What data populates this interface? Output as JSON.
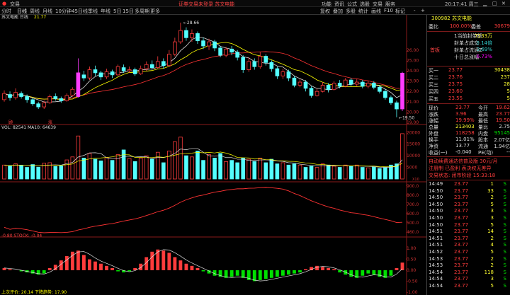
{
  "titlebar": {
    "menu_items": [
      "交易"
    ],
    "notice": "证券交易未登录  苏文电能",
    "right_items": [
      "功能",
      "资讯",
      "公式",
      "选股",
      "交易",
      "服务"
    ],
    "time": "20:17:41 周三",
    "window_buttons": [
      "minimize",
      "maximize",
      "close"
    ]
  },
  "toolbar": {
    "periods": [
      "分时",
      "日线",
      "周线",
      "月线",
      "10分钟",
      "45日线",
      "季线",
      "年线",
      "5日",
      "15日",
      "多周期",
      "更多"
    ],
    "active_period": "日线",
    "right_tabs": [
      "复权",
      "叠加",
      "画线",
      "F10",
      "标记",
      "-",
      "+"
    ],
    "right_tabs2": [
      "复权",
      "叠加",
      "多股",
      "统计",
      "画线",
      "F10",
      "标记"
    ]
  },
  "chart": {
    "stock_label": "苏文电能 日线",
    "ma_label": "21.77",
    "high_marker": "28.66",
    "low_marker": "19.50",
    "signal_labels": [
      "顾",
      "涨"
    ],
    "price_axis": [
      "26.00",
      "25.00",
      "24.00",
      "23.00",
      "22.00",
      "21.00",
      "20.00",
      "19.00"
    ],
    "volume_header": "VOL: 82541  MA10: 64639",
    "volume_axis": [
      "20000",
      "15000",
      "10000",
      "5000"
    ],
    "volume_unit": "X10",
    "mid_axis": [
      "900.0",
      "800.0",
      "700.0",
      "600.0",
      "500.0",
      "460.0"
    ],
    "macd_header": "-0.80  STOCK: -0.04",
    "macd_axis": [
      "1.00",
      "0.50",
      "0.00",
      "-0.50",
      "-1.00"
    ],
    "bottom_text": "上次评价: 20.14  下降趋势: 17.90"
  },
  "chart_data": {
    "type": "candlestick",
    "candles": [
      {
        "o": 21.2,
        "c": 21.8,
        "h": 22.1,
        "l": 21.0
      },
      {
        "o": 21.7,
        "c": 21.4,
        "h": 22.0,
        "l": 21.1
      },
      {
        "o": 21.4,
        "c": 21.9,
        "h": 22.3,
        "l": 21.2
      },
      {
        "o": 21.8,
        "c": 21.5,
        "h": 22.0,
        "l": 21.3
      },
      {
        "o": 21.5,
        "c": 21.2,
        "h": 21.7,
        "l": 20.9
      },
      {
        "o": 21.2,
        "c": 20.8,
        "h": 21.4,
        "l": 20.6
      },
      {
        "o": 20.8,
        "c": 20.5,
        "h": 21.0,
        "l": 20.3
      },
      {
        "o": 20.5,
        "c": 20.9,
        "h": 21.1,
        "l": 20.3
      },
      {
        "o": 20.9,
        "c": 21.5,
        "h": 21.7,
        "l": 20.8
      },
      {
        "o": 21.5,
        "c": 21.3,
        "h": 21.8,
        "l": 21.1
      },
      {
        "o": 21.3,
        "c": 21.1,
        "h": 21.5,
        "l": 20.9
      },
      {
        "o": 21.1,
        "c": 21.6,
        "h": 21.8,
        "l": 21.0
      },
      {
        "o": 21.6,
        "c": 22.2,
        "h": 22.4,
        "l": 21.5
      },
      {
        "o": 21.5,
        "c": 23.8,
        "h": 25.2,
        "l": 21.4
      },
      {
        "o": 23.6,
        "c": 23.3,
        "h": 24.0,
        "l": 23.0
      },
      {
        "o": 23.3,
        "c": 24.1,
        "h": 24.4,
        "l": 23.1
      },
      {
        "o": 24.1,
        "c": 23.8,
        "h": 24.5,
        "l": 23.5
      },
      {
        "o": 23.8,
        "c": 23.4,
        "h": 24.0,
        "l": 23.1
      },
      {
        "o": 23.4,
        "c": 23.9,
        "h": 24.2,
        "l": 23.2
      },
      {
        "o": 23.9,
        "c": 23.6,
        "h": 24.1,
        "l": 23.3
      },
      {
        "o": 23.6,
        "c": 24.4,
        "h": 24.6,
        "l": 23.5
      },
      {
        "o": 24.3,
        "c": 24.0,
        "h": 24.6,
        "l": 23.8
      },
      {
        "o": 24.0,
        "c": 24.1,
        "h": 24.4,
        "l": 23.8
      },
      {
        "o": 24.1,
        "c": 23.7,
        "h": 24.3,
        "l": 23.5
      },
      {
        "o": 23.7,
        "c": 24.2,
        "h": 24.5,
        "l": 23.6
      },
      {
        "o": 24.2,
        "c": 24.6,
        "h": 24.9,
        "l": 24.0
      },
      {
        "o": 24.6,
        "c": 24.3,
        "h": 25.0,
        "l": 24.1
      },
      {
        "o": 24.3,
        "c": 24.9,
        "h": 25.4,
        "l": 24.2
      },
      {
        "o": 24.9,
        "c": 24.5,
        "h": 25.2,
        "l": 24.2
      },
      {
        "o": 24.5,
        "c": 25.6,
        "h": 26.0,
        "l": 24.4
      },
      {
        "o": 25.6,
        "c": 26.8,
        "h": 27.2,
        "l": 25.4
      },
      {
        "o": 26.8,
        "c": 27.9,
        "h": 28.66,
        "l": 26.6
      },
      {
        "o": 27.9,
        "c": 27.2,
        "h": 28.2,
        "l": 26.9
      },
      {
        "o": 27.2,
        "c": 27.6,
        "h": 28.0,
        "l": 26.8
      },
      {
        "o": 27.6,
        "c": 26.9,
        "h": 27.8,
        "l": 26.6
      },
      {
        "o": 26.9,
        "c": 26.4,
        "h": 27.2,
        "l": 26.1
      },
      {
        "o": 26.4,
        "c": 26.8,
        "h": 27.1,
        "l": 26.0
      },
      {
        "o": 26.8,
        "c": 26.2,
        "h": 27.0,
        "l": 25.9
      },
      {
        "o": 26.2,
        "c": 25.5,
        "h": 26.4,
        "l": 25.3
      },
      {
        "o": 25.5,
        "c": 26.1,
        "h": 26.3,
        "l": 25.3
      },
      {
        "o": 26.1,
        "c": 25.8,
        "h": 26.4,
        "l": 25.5
      },
      {
        "o": 25.8,
        "c": 25.3,
        "h": 26.0,
        "l": 25.0
      },
      {
        "o": 25.3,
        "c": 24.1,
        "h": 25.5,
        "l": 23.8
      },
      {
        "o": 24.1,
        "c": 24.9,
        "h": 25.3,
        "l": 23.9
      },
      {
        "o": 24.9,
        "c": 24.4,
        "h": 25.2,
        "l": 24.1
      },
      {
        "o": 24.4,
        "c": 25.4,
        "h": 25.8,
        "l": 24.2
      },
      {
        "o": 25.4,
        "c": 24.8,
        "h": 25.6,
        "l": 24.5
      },
      {
        "o": 24.8,
        "c": 24.2,
        "h": 25.0,
        "l": 23.9
      },
      {
        "o": 24.2,
        "c": 23.5,
        "h": 24.4,
        "l": 23.2
      },
      {
        "o": 23.5,
        "c": 23.9,
        "h": 24.2,
        "l": 23.2
      },
      {
        "o": 23.9,
        "c": 23.3,
        "h": 24.1,
        "l": 23.0
      },
      {
        "o": 23.3,
        "c": 22.6,
        "h": 23.5,
        "l": 22.4
      },
      {
        "o": 22.6,
        "c": 22.9,
        "h": 23.2,
        "l": 22.4
      },
      {
        "o": 22.9,
        "c": 22.3,
        "h": 23.1,
        "l": 22.0
      },
      {
        "o": 22.3,
        "c": 21.6,
        "h": 22.5,
        "l": 21.4
      },
      {
        "o": 21.6,
        "c": 22.0,
        "h": 22.3,
        "l": 21.5
      },
      {
        "o": 22.0,
        "c": 22.6,
        "h": 22.9,
        "l": 21.9
      },
      {
        "o": 22.6,
        "c": 22.2,
        "h": 22.8,
        "l": 21.9
      },
      {
        "o": 22.2,
        "c": 22.8,
        "h": 23.0,
        "l": 22.1
      },
      {
        "o": 22.8,
        "c": 22.5,
        "h": 23.1,
        "l": 22.3
      },
      {
        "o": 22.5,
        "c": 23.1,
        "h": 23.3,
        "l": 22.4
      },
      {
        "o": 23.1,
        "c": 22.7,
        "h": 23.3,
        "l": 22.5
      },
      {
        "o": 22.7,
        "c": 22.9,
        "h": 23.2,
        "l": 22.5
      },
      {
        "o": 22.9,
        "c": 22.5,
        "h": 23.1,
        "l": 22.3
      },
      {
        "o": 22.5,
        "c": 22.8,
        "h": 23.0,
        "l": 22.3
      },
      {
        "o": 22.8,
        "c": 22.4,
        "h": 23.0,
        "l": 22.2
      },
      {
        "o": 22.4,
        "c": 22.0,
        "h": 22.6,
        "l": 21.8
      },
      {
        "o": 22.0,
        "c": 21.4,
        "h": 22.2,
        "l": 21.2
      },
      {
        "o": 21.4,
        "c": 20.9,
        "h": 21.6,
        "l": 20.7
      },
      {
        "o": 20.9,
        "c": 20.3,
        "h": 21.1,
        "l": 19.5
      },
      {
        "o": 20.3,
        "c": 23.77,
        "h": 23.9,
        "l": 20.1
      }
    ],
    "volumes": [
      6.0,
      5.5,
      6.5,
      5.8,
      5.0,
      6.2,
      5.1,
      6.8,
      7.0,
      5.4,
      5.6,
      8.2,
      9.5,
      18.5,
      9.0,
      11.0,
      8.5,
      7.8,
      9.2,
      8.0,
      10.5,
      12.5,
      8.8,
      7.5,
      9.0,
      10.0,
      8.5,
      11.5,
      7.0,
      12.0,
      16.0,
      18.0,
      10.0,
      9.5,
      12.0,
      8.0,
      10.5,
      9.0,
      11.0,
      7.5,
      8.0,
      7.0,
      9.0,
      8.5,
      7.5,
      9.0,
      7.0,
      8.5,
      6.5,
      7.0,
      6.0,
      6.5,
      6.0,
      5.0,
      5.5,
      5.0,
      6.5,
      6.0,
      5.5,
      5.0,
      6.0,
      5.5,
      6.0,
      5.0,
      4.8,
      5.2,
      4.5,
      5.0,
      6.0,
      6.5,
      19.5
    ],
    "macd": [
      0.1,
      0.05,
      0.0,
      -0.05,
      -0.1,
      -0.15,
      -0.2,
      -0.15,
      0.1,
      0.25,
      0.45,
      0.65,
      0.85,
      0.9,
      0.7,
      0.5,
      0.4,
      0.3,
      0.2,
      0.1,
      -0.05,
      -0.1,
      -0.05,
      0.1,
      0.3,
      0.6,
      0.85,
      0.95,
      0.9,
      0.8,
      0.6,
      0.45,
      0.3,
      0.2,
      0.1,
      -0.05,
      -0.15,
      -0.25,
      -0.3,
      -0.35,
      -0.3,
      -0.25,
      -0.35,
      -0.45,
      -0.5,
      -0.45,
      -0.4,
      -0.35,
      -0.3,
      -0.25,
      -0.2,
      -0.15,
      -0.1,
      0.05,
      0.15,
      0.2,
      0.15,
      0.1,
      0.05,
      -0.1,
      -0.2,
      -0.3,
      -0.35,
      -0.25,
      -0.15,
      -0.2,
      -0.3,
      -0.35,
      -0.25,
      0.1,
      0.35
    ],
    "ylim": [
      19.0,
      29.0
    ]
  },
  "panel": {
    "code_name": "300982 苏文电能",
    "weibi_label": "委比",
    "weibi_value": "100.00%",
    "weicha_label": "委差",
    "weicha_value": "30679",
    "board_label": "首板",
    "board_info": [
      {
        "label": "1当前封单额",
        "value": "7233万"
      },
      {
        "label": "封单占成交",
        "value": "0.14倍"
      },
      {
        "label": "封单占流通Z",
        "value": "3.69%"
      },
      {
        "label": "十日总涨幅",
        "value": "6.73%"
      }
    ],
    "sell_rows": [
      {
        "label": "卖五",
        "price": "",
        "vol": ""
      },
      {
        "label": "卖四",
        "price": "",
        "vol": ""
      },
      {
        "label": "卖三",
        "price": "",
        "vol": ""
      },
      {
        "label": "卖二",
        "price": "",
        "vol": ""
      },
      {
        "label": "卖一",
        "price": "",
        "vol": ""
      }
    ],
    "buy_rows": [
      {
        "label": "买一",
        "price": "23.77",
        "vol": "30438"
      },
      {
        "label": "买二",
        "price": "23.76",
        "vol": "237"
      },
      {
        "label": "买三",
        "price": "23.75",
        "vol": "28"
      },
      {
        "label": "买四",
        "price": "23.60",
        "vol": "5"
      },
      {
        "label": "买五",
        "price": "23.55",
        "vol": "5"
      }
    ],
    "stats": [
      {
        "l1": "现价",
        "v1": "23.77",
        "l2": "今开",
        "v2": "19.62"
      },
      {
        "l1": "涨跌",
        "v1": "3.96",
        "l2": "最高",
        "v2": "23.77"
      },
      {
        "l1": "涨幅",
        "v1": "19.99%",
        "l2": "最低",
        "v2": "19.50"
      },
      {
        "l1": "总量",
        "v1": "213403",
        "l2": "量比",
        "v2": "2.75"
      },
      {
        "l1": "外盘",
        "v1": "118258",
        "l2": "内盘",
        "v2": "95145"
      },
      {
        "l1": "换手",
        "v1": "11.01%",
        "l2": "股本",
        "v2": "2.07亿"
      },
      {
        "l1": "净资",
        "v1": "13.77",
        "l2": "流通",
        "v2": "1.94亿"
      },
      {
        "l1": "收益(一)",
        "v1": "-0.040",
        "l2": "PE(动)",
        "v2": "--"
      }
    ],
    "news1": "自动续费通达信普及版  30元/月",
    "news2": "注册制 已盈利 表决权无差异",
    "news3": "交易状态: 闭市阶段  15:33:18",
    "ticks": [
      {
        "t": "14:49",
        "p": "23.77",
        "v": "1",
        "s": "S"
      },
      {
        "t": "14:50",
        "p": "23.77",
        "v": "33",
        "s": "S"
      },
      {
        "t": "14:50",
        "p": "23.77",
        "v": "2",
        "s": "S"
      },
      {
        "t": "14:50",
        "p": "23.77",
        "v": "5",
        "s": "S"
      },
      {
        "t": "14:50",
        "p": "23.77",
        "v": "3",
        "s": "S"
      },
      {
        "t": "14:50",
        "p": "23.77",
        "v": "3",
        "s": "S"
      },
      {
        "t": "14:50",
        "p": "23.77",
        "v": "5",
        "s": "S"
      },
      {
        "t": "14:51",
        "p": "23.77",
        "v": "14",
        "s": "S"
      },
      {
        "t": "14:51",
        "p": "23.77",
        "v": "2",
        "s": "S"
      },
      {
        "t": "14:51",
        "p": "23.77",
        "v": "4",
        "s": "S"
      },
      {
        "t": "14:52",
        "p": "23.77",
        "v": "5",
        "s": "S"
      },
      {
        "t": "14:53",
        "p": "23.77",
        "v": "2",
        "s": "S"
      },
      {
        "t": "14:53",
        "p": "23.77",
        "v": "2",
        "s": "S"
      },
      {
        "t": "14:54",
        "p": "23.77",
        "v": "118",
        "s": "S"
      },
      {
        "t": "14:54",
        "p": "23.77",
        "v": "3",
        "s": "S"
      },
      {
        "t": "14:54",
        "p": "23.77",
        "v": "5",
        "s": "S"
      }
    ]
  }
}
